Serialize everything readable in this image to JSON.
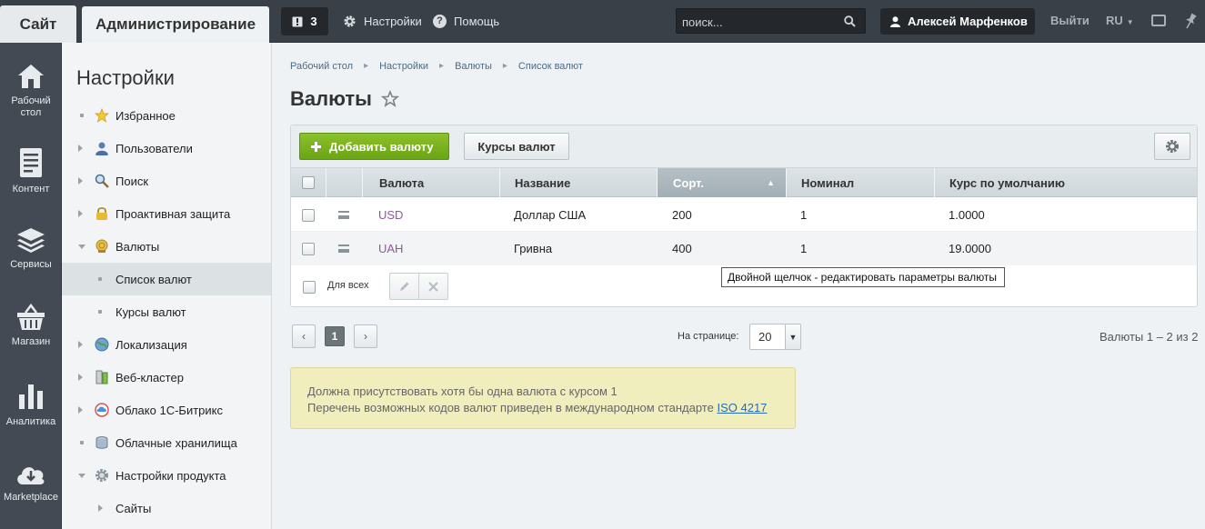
{
  "topbar": {
    "site_tab": "Сайт",
    "admin_tab": "Администрирование",
    "notifications_count": "3",
    "settings_link": "Настройки",
    "help_link": "Помощь",
    "search_placeholder": "поиск...",
    "user_name": "Алексей Марфенков",
    "logout": "Выйти",
    "language": "RU"
  },
  "iconbar": {
    "items": [
      {
        "label": "Рабочий стол",
        "icon": "home-icon"
      },
      {
        "label": "Контент",
        "icon": "document-icon"
      },
      {
        "label": "Сервисы",
        "icon": "layers-icon"
      },
      {
        "label": "Магазин",
        "icon": "basket-icon"
      },
      {
        "label": "Аналитика",
        "icon": "bar-chart-icon"
      },
      {
        "label": "Marketplace",
        "icon": "cloud-download-icon"
      }
    ]
  },
  "sidebar": {
    "title": "Настройки",
    "items": [
      {
        "label": "Избранное",
        "icon": "star-icon"
      },
      {
        "label": "Пользователи",
        "icon": "user-icon"
      },
      {
        "label": "Поиск",
        "icon": "magnifier-icon"
      },
      {
        "label": "Проактивная защита",
        "icon": "lock-icon"
      },
      {
        "label": "Валюты",
        "icon": "coin-icon"
      },
      {
        "label": "Список валют"
      },
      {
        "label": "Курсы валют"
      },
      {
        "label": "Локализация",
        "icon": "globe-icon"
      },
      {
        "label": "Веб-кластер",
        "icon": "cluster-icon"
      },
      {
        "label": "Облако 1С-Битрикс",
        "icon": "cloud-icon"
      },
      {
        "label": "Облачные хранилища",
        "icon": "storage-icon"
      },
      {
        "label": "Настройки продукта",
        "icon": "gear-icon"
      },
      {
        "label": "Сайты"
      }
    ]
  },
  "breadcrumbs": [
    "Рабочий стол",
    "Настройки",
    "Валюты",
    "Список валют"
  ],
  "page": {
    "title": "Валюты"
  },
  "toolbar": {
    "add_label": "Добавить валюту",
    "rates_label": "Курсы валют"
  },
  "table": {
    "columns": [
      "Валюта",
      "Название",
      "Сорт.",
      "Номинал",
      "Курс по умолчанию"
    ],
    "rows": [
      {
        "code": "USD",
        "name": "Доллар США",
        "sort": "200",
        "nominal": "1",
        "rate": "1.0000"
      },
      {
        "code": "UAH",
        "name": "Гривна",
        "sort": "400",
        "nominal": "1",
        "rate": "19.0000"
      }
    ],
    "for_all_label": "Для всех",
    "tooltip": "Двойной щелчок - редактировать параметры валюты"
  },
  "pagination": {
    "current_page": "1",
    "per_page_label": "На странице:",
    "per_page_value": "20",
    "count_label": "Валюты 1 – 2 из 2"
  },
  "note": {
    "line1": "Должна присутствовать хотя бы одна валюта с курсом 1",
    "line2": "Перечень возможных кодов валют приведен в международном стандарте",
    "link": "ISO 4217"
  },
  "colors": {
    "topbar": "#3a4048",
    "accent_green": "#7cb51f",
    "link": "#2a6bb0",
    "note_bg": "#f1eebd"
  }
}
